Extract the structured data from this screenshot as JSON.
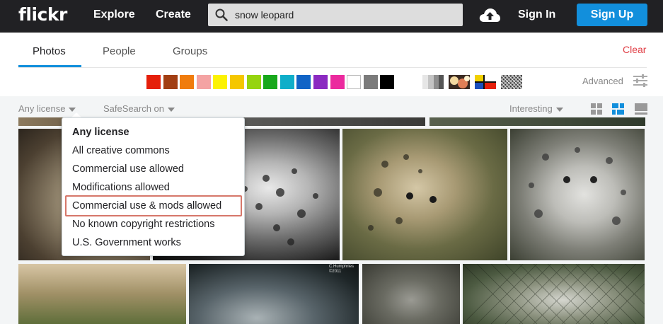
{
  "header": {
    "logo": "flickr",
    "nav": [
      "Explore",
      "Create"
    ],
    "search": {
      "value": "snow leopard",
      "placeholder": ""
    },
    "sign_in": "Sign In",
    "sign_up": "Sign Up"
  },
  "tabs": [
    {
      "label": "Photos",
      "active": true
    },
    {
      "label": "People",
      "active": false
    },
    {
      "label": "Groups",
      "active": false
    }
  ],
  "clear_label": "Clear",
  "advanced_label": "Advanced",
  "colors": [
    "#e51f0a",
    "#a23e12",
    "#f07c0d",
    "#f4a3a3",
    "#fcf204",
    "#f5c700",
    "#96d40f",
    "#18a81c",
    "#0faec9",
    "#1164c6",
    "#8b2ac1",
    "#eb2a9e",
    "#ffffff",
    "#7b7b7b",
    "#000000"
  ],
  "filters": {
    "license": "Any license",
    "safesearch": "SafeSearch on",
    "sort": "Interesting"
  },
  "license_menu": {
    "items": [
      "Any license",
      "All creative commons",
      "Commercial use allowed",
      "Modifications allowed",
      "Commercial use & mods allowed",
      "No known copyright restrictions",
      "U.S. Government works"
    ],
    "selected_index": 0,
    "highlighted_index": 4
  },
  "photo_credit": "C.Humphries ©2011"
}
